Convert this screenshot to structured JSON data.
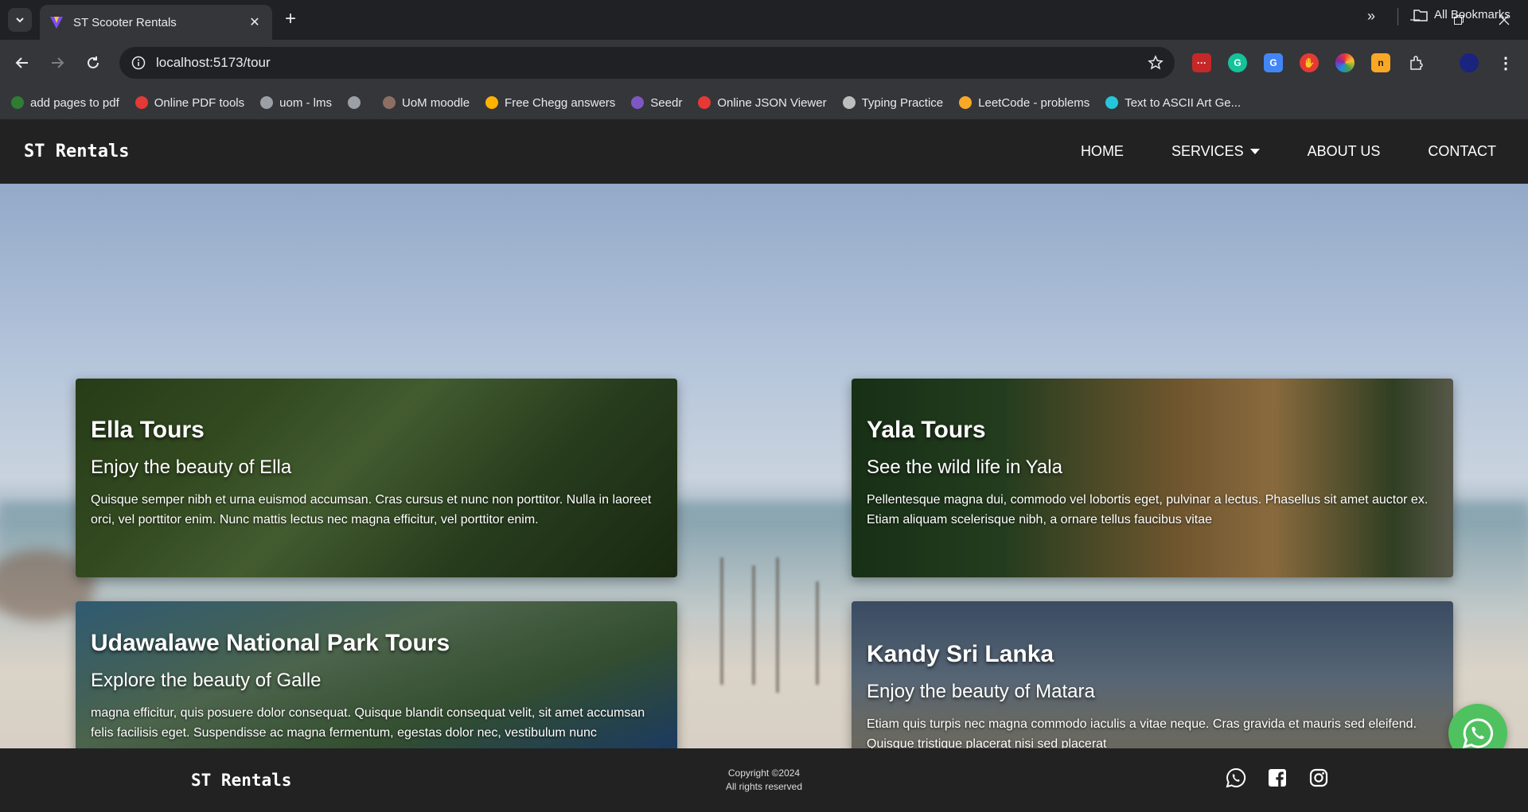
{
  "browser": {
    "tab_title": "ST Scooter Rentals",
    "url": "localhost:5173/tour",
    "bookmarks": [
      {
        "label": "add pages to pdf",
        "color": "#2e7d32"
      },
      {
        "label": "Online PDF tools",
        "color": "#e53935"
      },
      {
        "label": "uom - lms",
        "color": "#9aa0a6"
      },
      {
        "label": "",
        "color": "#9aa0a6"
      },
      {
        "label": "UoM moodle",
        "color": "#8d6e63"
      },
      {
        "label": "Free Chegg answers",
        "color": "#ffb300"
      },
      {
        "label": "Seedr",
        "color": "#7e57c2"
      },
      {
        "label": "Online JSON Viewer",
        "color": "#e53935"
      },
      {
        "label": "Typing Practice",
        "color": "#bdbdbd"
      },
      {
        "label": "LeetCode - problems",
        "color": "#f9a825"
      },
      {
        "label": "Text to ASCII Art Ge...",
        "color": "#26c6da"
      }
    ],
    "all_bookmarks": "All Bookmarks"
  },
  "site": {
    "brand": "ST Rentals",
    "nav": {
      "home": "HOME",
      "services": "SERVICES",
      "about": "ABOUT US",
      "contact": "CONTACT"
    }
  },
  "tours": [
    {
      "title": "Ella Tours",
      "subtitle": "Enjoy the beauty of Ella",
      "text": "Quisque semper nibh et urna euismod accumsan. Cras cursus et nunc non porttitor. Nulla in laoreet orci, vel porttitor enim. Nunc mattis lectus nec magna efficitur, vel porttitor enim."
    },
    {
      "title": "Yala Tours",
      "subtitle": "See the wild life in Yala",
      "text": "Pellentesque magna dui, commodo vel lobortis eget, pulvinar a lectus. Phasellus sit amet auctor ex. Etiam aliquam scelerisque nibh, a ornare tellus faucibus vitae"
    },
    {
      "title": "Udawalawe National Park Tours",
      "subtitle": "Explore the beauty of Galle",
      "text": "magna efficitur, quis posuere dolor consequat. Quisque blandit consequat velit, sit amet accumsan felis facilisis eget. Suspendisse ac magna fermentum, egestas dolor nec, vestibulum nunc"
    },
    {
      "title": "Kandy Sri Lanka",
      "subtitle": "Enjoy the beauty of Matara",
      "text": "Etiam quis turpis nec magna commodo iaculis a vitae neque. Cras gravida et mauris sed eleifend. Quisque tristique placerat nisi sed placerat"
    }
  ],
  "footer": {
    "brand": "ST Rentals",
    "copyright": "Copyright ©2024",
    "rights": "All rights reserved",
    "social_icons": [
      "whatsapp-icon",
      "facebook-icon",
      "instagram-icon"
    ]
  },
  "colors": {
    "nav_bg": "#222222",
    "whatsapp_green": "#4fc15f"
  }
}
